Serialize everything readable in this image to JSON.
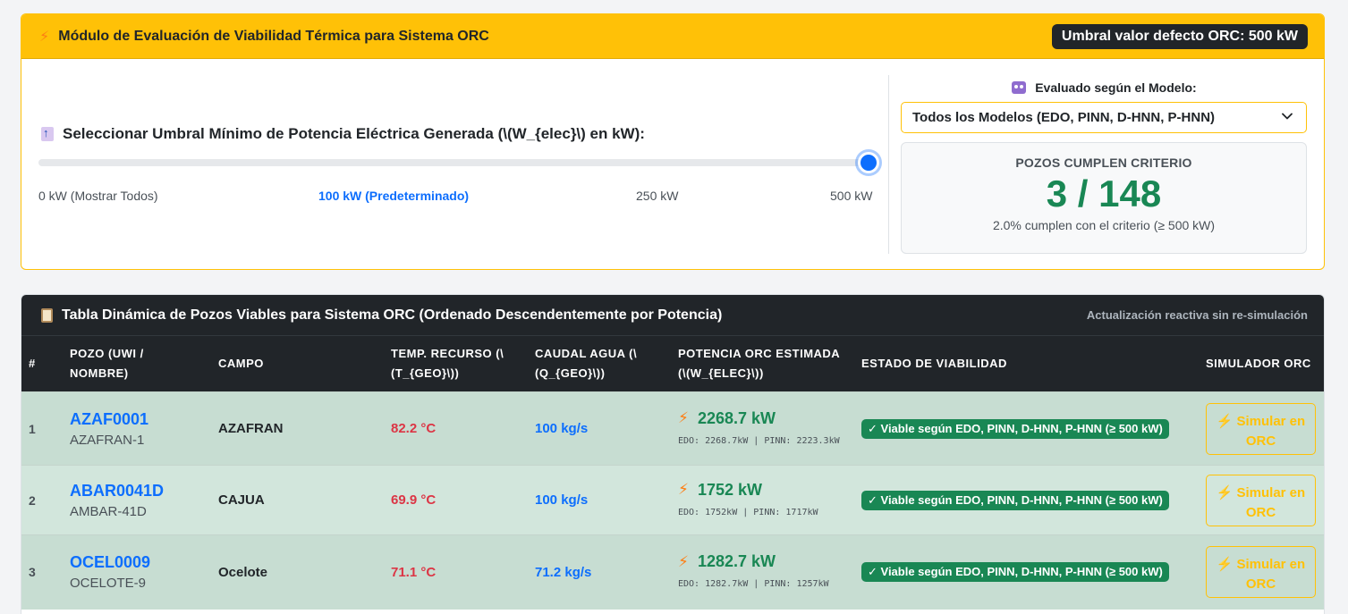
{
  "card1": {
    "title": "Módulo de Evaluación de Viabilidad Térmica para Sistema ORC",
    "default_badge": "Umbral valor defecto ORC: 500 kW",
    "slider": {
      "label": "Seleccionar Umbral Mínimo de Potencia Eléctrica Generada (\\(W_{elec}\\) en kW):",
      "value_kw": 500,
      "ticks": [
        "0 kW (Mostrar Todos)",
        "100 kW (Predeterminado)",
        "250 kW",
        "500 kW"
      ]
    },
    "model": {
      "label": "Evaluado según el Modelo:",
      "selected": "Todos los Modelos (EDO, PINN, D-HNN, P-HNN)"
    },
    "count": {
      "title": "POZOS CUMPLEN CRITERIO",
      "value": "3 / 148",
      "subtitle": "2.0% cumplen con el criterio (≥ 500 kW)"
    }
  },
  "table": {
    "title": "Tabla Dinámica de Pozos Viables para Sistema ORC (Ordenado Descendentemente por Potencia)",
    "note": "Actualización reactiva sin re-simulación",
    "headers": {
      "idx": "#",
      "pozo": "POZO (UWI / NOMBRE)",
      "campo": "CAMPO",
      "temp": "TEMP. RECURSO (\\(T_{GEO}\\))",
      "caudal": "CAUDAL AGUA (\\(Q_{GEO}\\))",
      "potencia": "POTENCIA ORC ESTIMADA (\\(W_{ELEC}\\))",
      "estado": "ESTADO DE VIABILIDAD",
      "simulador": "SIMULADOR ORC"
    },
    "rows": [
      {
        "idx": "1",
        "uwi": "AZAF0001",
        "name": "AZAFRAN-1",
        "campo": "AZAFRAN",
        "temp": "82.2 °C",
        "flow": "100 kg/s",
        "power": "2268.7 kW",
        "detail": "EDO: 2268.7kW | PINN: 2223.3kW",
        "status": "✓ Viable según EDO, PINN, D-HNN, P-HNN (≥ 500 kW)",
        "button": "Simular en ORC"
      },
      {
        "idx": "2",
        "uwi": "ABAR0041D",
        "name": "AMBAR-41D",
        "campo": "CAJUA",
        "temp": "69.9 °C",
        "flow": "100 kg/s",
        "power": "1752 kW",
        "detail": "EDO: 1752kW | PINN: 1717kW",
        "status": "✓ Viable según EDO, PINN, D-HNN, P-HNN (≥ 500 kW)",
        "button": "Simular en ORC"
      },
      {
        "idx": "3",
        "uwi": "OCEL0009",
        "name": "OCELOTE-9",
        "campo": "Ocelote",
        "temp": "71.1 °C",
        "flow": "71.2 kg/s",
        "power": "1282.7 kW",
        "detail": "EDO: 1282.7kW | PINN: 1257kW",
        "status": "✓ Viable según EDO, PINN, D-HNN, P-HNN (≥ 500 kW)",
        "button": "Simular en ORC"
      }
    ]
  }
}
